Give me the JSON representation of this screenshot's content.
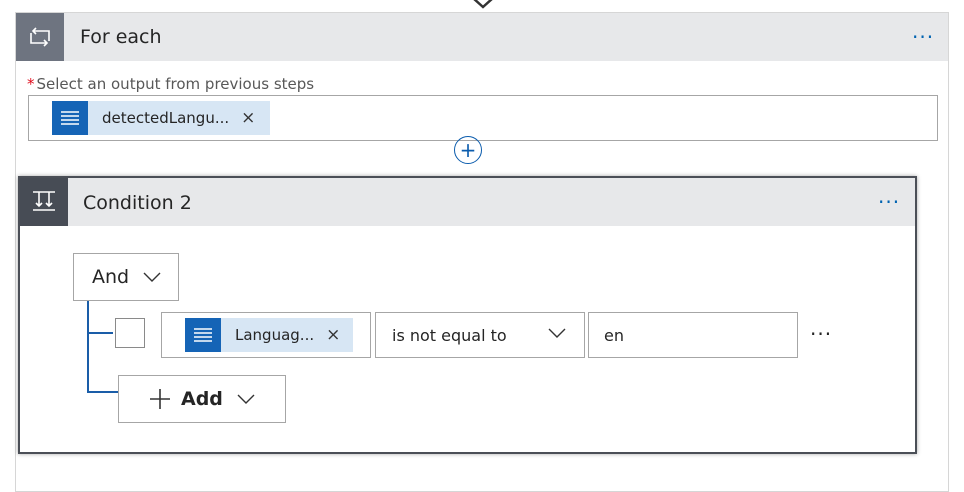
{
  "foreach": {
    "title": "For each",
    "more": "···",
    "select_label": "Select an output from previous steps",
    "required_mark": "*",
    "token": {
      "text": "detectedLangu...",
      "remove": "×",
      "icon": "text-lines-icon"
    },
    "icon": "loop-icon",
    "add_step": "+"
  },
  "condition": {
    "title": "Condition 2",
    "more": "···",
    "icon": "condition-icon",
    "group_operator": "And",
    "row": {
      "token": {
        "text": "Languag...",
        "remove": "×",
        "icon": "text-lines-icon"
      },
      "operator": "is not equal to",
      "value": "en",
      "more": "···"
    },
    "add_label": "Add"
  },
  "colors": {
    "accent": "#0063b1",
    "token_bg": "#d7e6f4",
    "token_icon": "#1564b6",
    "header_bg": "#e7e8ea",
    "required": "#e00b1c"
  }
}
